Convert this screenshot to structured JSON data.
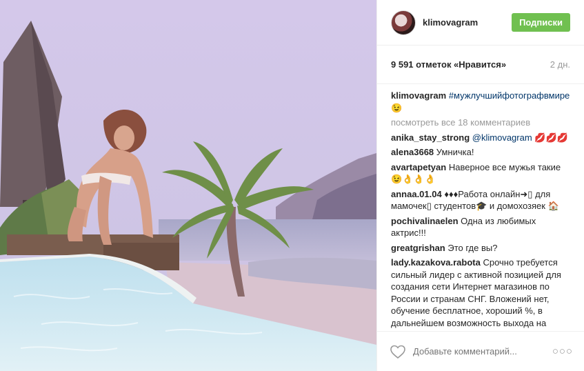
{
  "post": {
    "username": "klimovagram",
    "follow_label": "Подписки",
    "likes_text": "9 591 отметок «Нравится»",
    "age_text": "2 дн."
  },
  "caption": {
    "username": "klimovagram",
    "hashtag": "#мужлучшийфотографвмире",
    "emoji": "😉"
  },
  "view_all_comments": "посмотреть все 18 комментариев",
  "comments": [
    {
      "user": "anika_stay_strong",
      "mention": "@klimovagram",
      "text": " 💋💋💋"
    },
    {
      "user": "alena3668",
      "text": "Умничка!"
    },
    {
      "user": "avartapetyan",
      "text": "Наверное все мужья такие 😉👌👌👌"
    },
    {
      "user": "annaa.01.04",
      "text": "♦♦♦Работа онлайн➜▯ для мамочек▯ студентов🎓 и домохозяек 🏠"
    },
    {
      "user": "pochivalinaelen",
      "text": "Одна из любимых актрис!!!"
    },
    {
      "user": "greatgrishan",
      "text": "Это где вы?"
    },
    {
      "user": "lady.kazakova.rabota",
      "text": "Срочно требуется сильный лидер с активной позицией для создания сети Интернет магазинов по России и странам СНГ. Вложений нет, обучение бесплатное, хороший %, в дальнейшем возможность выхода на"
    }
  ],
  "footer": {
    "comment_placeholder": "Добавьте комментарий...",
    "more_label": "○○○",
    "heart_icon": "heart-outline-icon",
    "more_icon": "more-options-icon"
  },
  "colors": {
    "follow_green": "#70c050",
    "link_blue": "#003569",
    "muted_gray": "#999999"
  }
}
